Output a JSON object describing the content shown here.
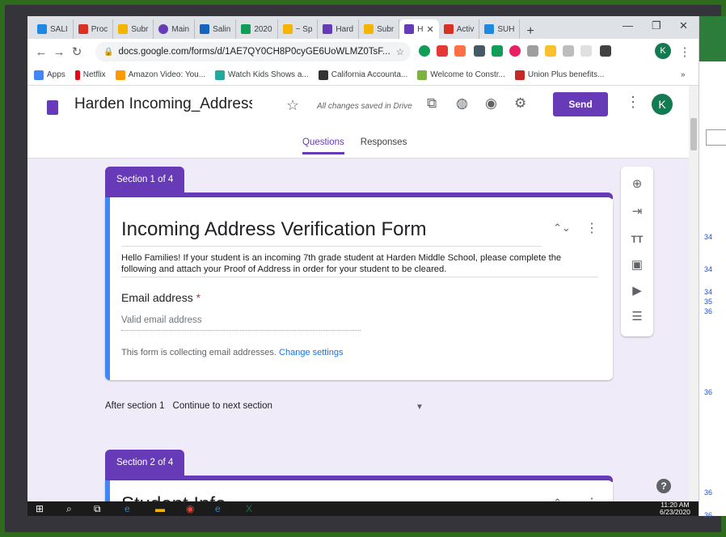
{
  "browser": {
    "tabs": [
      {
        "label": "SALI",
        "color": "#1e88e5"
      },
      {
        "label": "Proc",
        "color": "#d93025"
      },
      {
        "label": "Subr",
        "color": "#f4b400"
      },
      {
        "label": "Main",
        "color": "#673ab7"
      },
      {
        "label": "Salin",
        "color": "#1565c0"
      },
      {
        "label": "2020",
        "color": "#0f9d58"
      },
      {
        "label": "~ Sp",
        "color": "#f4b400"
      },
      {
        "label": "Hard",
        "color": "#673ab7"
      },
      {
        "label": "Subr",
        "color": "#f4b400"
      },
      {
        "label": "H",
        "color": "#673ab7"
      },
      {
        "label": "Activ",
        "color": "#d93025"
      },
      {
        "label": "SUH",
        "color": "#1e88e5"
      }
    ],
    "url": "docs.google.com/forms/d/1AE7QY0CH8P0cyGE6UoWLMZ0TsF...",
    "profile_initial": "K",
    "bookmarks": [
      {
        "label": "Apps",
        "color": "#4285f4"
      },
      {
        "label": "Netflix",
        "color": "#e50914"
      },
      {
        "label": "Amazon Video: You...",
        "color": "#ff9900"
      },
      {
        "label": "Watch Kids Shows a...",
        "color": "#23a89b"
      },
      {
        "label": "California Accounta...",
        "color": "#333333"
      },
      {
        "label": "Welcome to Constr...",
        "color": "#7cb342"
      },
      {
        "label": "Union Plus benefits...",
        "color": "#c62828"
      }
    ]
  },
  "form": {
    "title": "Harden Incoming_Address",
    "save_status": "All changes saved in Drive",
    "send_label": "Send",
    "avatar_initial": "K",
    "tabs": {
      "questions": "Questions",
      "responses": "Responses"
    },
    "section1": {
      "label": "Section 1 of 4",
      "title": "Incoming Address Verification Form",
      "description": "Hello Families! If your student is an incoming 7th grade student at Harden Middle School, please complete the following and attach your Proof of Address in order for your student to be cleared.",
      "email_label": "Email address",
      "required_mark": "*",
      "email_placeholder": "Valid email address",
      "collecting_note": "This form is collecting email addresses.",
      "change_settings": "Change settings"
    },
    "after_section": {
      "label": "After section 1",
      "value": "Continue to next section"
    },
    "section2": {
      "label": "Section 2 of 4",
      "title": "Student Info"
    }
  },
  "background_window": {
    "cells": [
      "34",
      "34",
      "34",
      "35",
      "36",
      "36",
      "36",
      "36"
    ]
  },
  "taskbar": {
    "time": "11:20 AM",
    "date": "6/23/2020"
  },
  "colors": {
    "accent": "#673ab7",
    "blue_bar": "#4285f4",
    "form_bg": "#f0ebf8"
  }
}
